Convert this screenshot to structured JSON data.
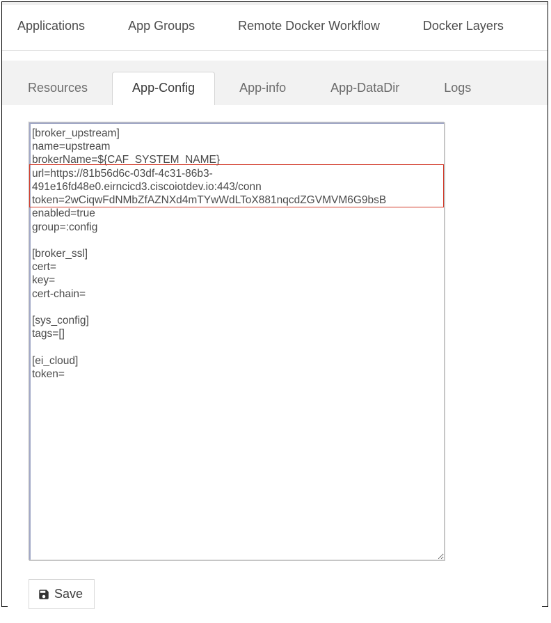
{
  "primary_nav": {
    "items": [
      {
        "label": "Applications"
      },
      {
        "label": "App Groups"
      },
      {
        "label": "Remote Docker Workflow"
      },
      {
        "label": "Docker Layers"
      }
    ]
  },
  "tabs": {
    "items": [
      {
        "label": "Resources",
        "active": false
      },
      {
        "label": "App-Config",
        "active": true
      },
      {
        "label": "App-info",
        "active": false
      },
      {
        "label": "App-DataDir",
        "active": false
      },
      {
        "label": "Logs",
        "active": false
      }
    ]
  },
  "config": {
    "text": "[broker_upstream]\nname=upstream\nbrokerName=${CAF_SYSTEM_NAME}\nurl=https://81b56d6c-03df-4c31-86b3-491e16fd48e0.eirncicd3.ciscoiotdev.io:443/conn\ntoken=2wCiqwFdNMbZfAZNXd4mTYwWdLToX881nqcdZGVMVM6G9bsB\nenabled=true\ngroup=:config\n\n[broker_ssl]\ncert=\nkey=\ncert-chain=\n\n[sys_config]\ntags=[]\n\n[ei_cloud]\ntoken="
  },
  "buttons": {
    "save_label": "Save"
  }
}
